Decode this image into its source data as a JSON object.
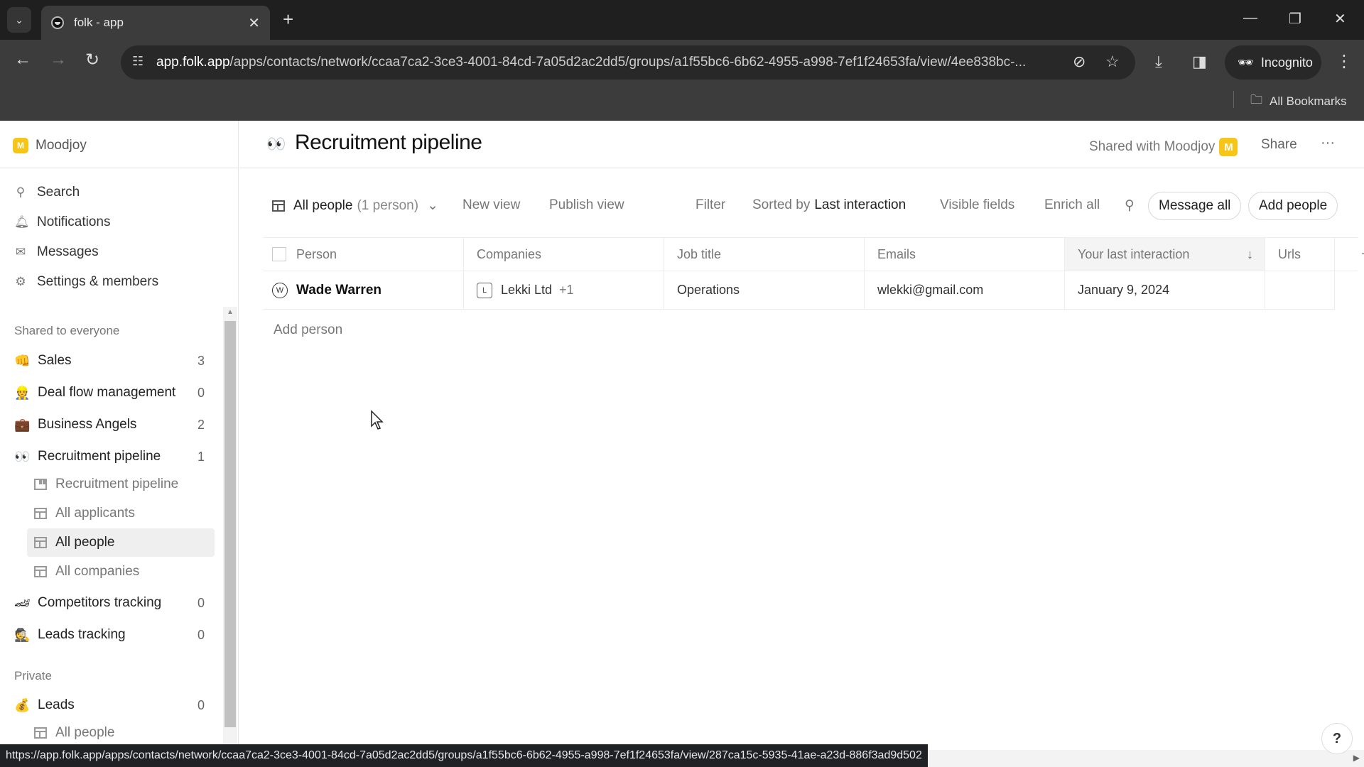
{
  "browser": {
    "tab_title": "folk - app",
    "url_host": "app.folk.app",
    "url_path": "/apps/contacts/network/ccaa7ca2-3ce3-4001-84cd-7a05d2ac2dd5/groups/a1f55bc6-6b62-4955-a998-7ef1f24653fa/view/4ee838bc-...",
    "incognito_label": "Incognito",
    "bookmarks_label": "All Bookmarks",
    "status_url": "https://app.folk.app/apps/contacts/network/ccaa7ca2-3ce3-4001-84cd-7a05d2ac2dd5/groups/a1f55bc6-6b62-4955-a998-7ef1f24653fa/view/287ca15c-5935-41ae-a23d-886f3ad9d502"
  },
  "sidebar": {
    "workspace": {
      "initial": "M",
      "name": "Moodjoy"
    },
    "nav": [
      {
        "label": "Search",
        "icon": "search-icon"
      },
      {
        "label": "Notifications",
        "icon": "bell-icon"
      },
      {
        "label": "Messages",
        "icon": "mail-icon"
      },
      {
        "label": "Settings & members",
        "icon": "gear-icon"
      }
    ],
    "shared_section_label": "Shared to everyone",
    "groups": [
      {
        "emoji": "👊",
        "label": "Sales",
        "count": "3"
      },
      {
        "emoji": "👷",
        "label": "Deal flow management",
        "count": "0"
      },
      {
        "emoji": "💼",
        "label": "Business Angels",
        "count": "2"
      },
      {
        "emoji": "👀",
        "label": "Recruitment pipeline",
        "count": "1"
      }
    ],
    "recruitment_views": [
      {
        "label": "Recruitment pipeline",
        "type": "kanban"
      },
      {
        "label": "All applicants",
        "type": "table"
      },
      {
        "label": "All people",
        "type": "table",
        "active": true
      },
      {
        "label": "All companies",
        "type": "table"
      }
    ],
    "groups_after": [
      {
        "emoji": "🏎",
        "label": "Competitors tracking",
        "count": "0"
      },
      {
        "emoji": "🕵",
        "label": "Leads tracking",
        "count": "0"
      }
    ],
    "private_section_label": "Private",
    "private_groups": [
      {
        "emoji": "💰",
        "label": "Leads",
        "count": "0"
      }
    ],
    "private_views": [
      {
        "label": "All people",
        "type": "table"
      }
    ]
  },
  "header": {
    "emoji": "👀",
    "title": "Recruitment pipeline",
    "shared_with": "Shared with Moodjoy",
    "shared_initial": "M",
    "share_label": "Share",
    "more_label": "···"
  },
  "viewbar": {
    "view_name": "All people",
    "view_count": "(1 person)",
    "new_view": "New view",
    "publish_view": "Publish view",
    "filter": "Filter",
    "sorted_by_prefix": "Sorted by",
    "sorted_by_field": "Last interaction",
    "visible_fields": "Visible fields",
    "enrich_all": "Enrich all",
    "message_all": "Message all",
    "add_people": "Add people"
  },
  "table": {
    "columns": [
      "Person",
      "Companies",
      "Job title",
      "Emails",
      "Your last interaction",
      "Urls"
    ],
    "sorted_column": "Your last interaction",
    "rows": [
      {
        "initial": "W",
        "person": "Wade Warren",
        "company_initial": "L",
        "company": "Lekki Ltd",
        "company_more": "+1",
        "job_title": "Operations",
        "email": "wlekki@gmail.com",
        "last_interaction": "January 9, 2024",
        "urls": ""
      }
    ],
    "add_person_label": "Add person",
    "add_column_label": "+"
  },
  "help_label": "?"
}
